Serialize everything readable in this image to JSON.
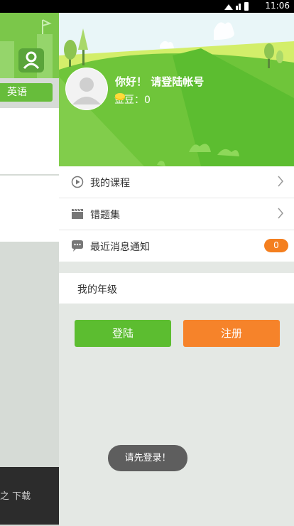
{
  "status_bar": {
    "time": "11:06"
  },
  "background_page": {
    "subject_chip": "英语",
    "download_label": "之 下载"
  },
  "profile": {
    "greeting": "你好！ 请登陆帐号",
    "coins_label": "金豆：0"
  },
  "menu": {
    "items": [
      {
        "label": "我的课程",
        "icon": "play-circle-icon"
      },
      {
        "label": "错题集",
        "icon": "clapperboard-icon"
      },
      {
        "label": "最近消息通知",
        "icon": "chat-bubble-icon",
        "badge": "0"
      }
    ]
  },
  "grade": {
    "label": "我的年级"
  },
  "buttons": {
    "login": "登陆",
    "register": "注册"
  },
  "toast": {
    "text": "请先登录！"
  },
  "colors": {
    "green": "#5cbd30",
    "orange": "#f6832a",
    "badge": "#f47f1f"
  }
}
